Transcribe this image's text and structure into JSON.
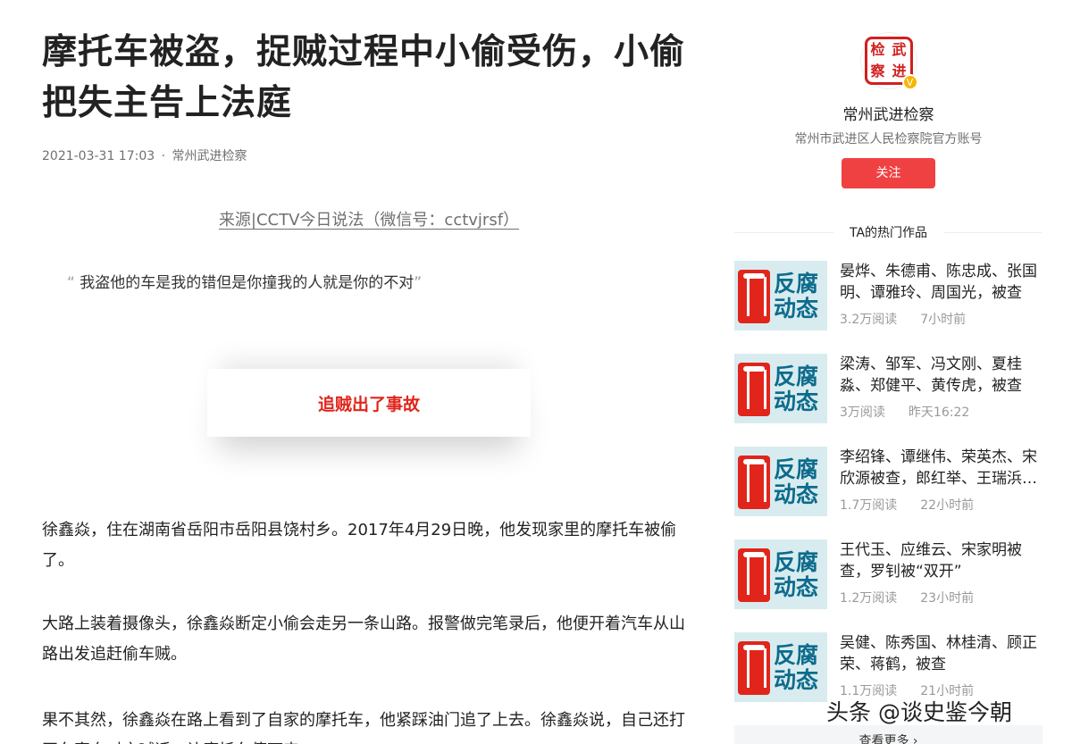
{
  "article": {
    "title": "摩托车被盗，捉贼过程中小偷受伤，小偷把失主告上法庭",
    "date": "2021-03-31 17:03",
    "meta_sep": "·",
    "author": "常州武进检察",
    "source": "来源|CCTV今日说法（微信号：cctvjrsf）",
    "quote_open": "“",
    "quote_text": "我盗他的车是我的错但是你撞我的人就是你的不对",
    "quote_close": "”",
    "highlight": "追贼出了事故",
    "paragraphs": [
      "徐鑫焱，住在湖南省岳阳市岳阳县饶村乡。2017年4月29日晚，他发现家里的摩托车被偷了。",
      "大路上装着摄像头，徐鑫焱断定小偷会走另一条山路。报警做完笔录后，他便开着汽车从山路出发追赶偷车贼。",
      "果不其然，徐鑫焱在路上看到了自家的摩托车，他紧踩油门追了上去。徐鑫焱说，自己还打开车窗向对方喊话，让摩托车停下来。"
    ]
  },
  "sidebar": {
    "avatar_chars": [
      "检",
      "武",
      "察",
      "进"
    ],
    "verify_mark": "V",
    "author_name": "常州武进检察",
    "author_desc": "常州市武进区人民检察院官方账号",
    "follow_label": "关注",
    "hot_heading": "TA的热门作品",
    "thumb_words": [
      "反腐",
      "动态"
    ],
    "hot_items": [
      {
        "title": "晏烨、朱德甫、陈忠成、张国明、谭雅玲、周国光，被查",
        "reads": "3.2万阅读",
        "time": "7小时前"
      },
      {
        "title": "梁涛、邹军、冯文刚、夏桂淼、郑健平、黄传虎，被查",
        "reads": "3万阅读",
        "time": "昨天16:22"
      },
      {
        "title": "李绍锋、谭继伟、荣英杰、宋欣源被查，郎红举、王瑞浜…",
        "reads": "1.7万阅读",
        "time": "22小时前"
      },
      {
        "title": "王代玉、应维云、宋家明被查，罗钊被“双开”",
        "reads": "1.2万阅读",
        "time": "23小时前"
      },
      {
        "title": "吴健、陈秀国、林桂清、顾正荣、蒋鹤，被查",
        "reads": "1.1万阅读",
        "time": "21小时前"
      }
    ],
    "more_label": "查看更多 ›"
  },
  "watermark": "头条 @谈史鉴今朝"
}
